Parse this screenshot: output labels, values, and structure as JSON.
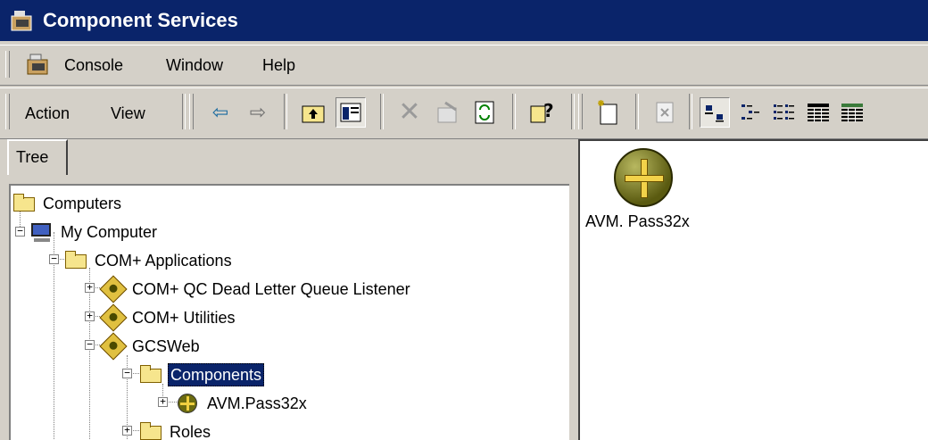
{
  "window": {
    "title": "Component Services"
  },
  "menu": {
    "items": [
      "Console",
      "Window",
      "Help"
    ]
  },
  "toolbar": {
    "action_label": "Action",
    "view_label": "View",
    "icons": [
      "back-icon",
      "forward-icon",
      "up-level-icon",
      "show-hide-tree-icon",
      "delete-icon",
      "properties-icon",
      "refresh-icon",
      "help-icon",
      "new-icon",
      "export-list-icon",
      "large-icons-view-icon",
      "small-icons-view-icon",
      "list-view-icon",
      "detail-view-icon",
      "status-view-icon"
    ]
  },
  "tabs": {
    "tree": "Tree"
  },
  "tree": {
    "computers": "Computers",
    "my_computer": "My Computer",
    "com_apps": "COM+ Applications",
    "qc_listener": "COM+ QC Dead Letter Queue Listener",
    "utilities": "COM+ Utilities",
    "gcsweb": "GCSWeb",
    "components": "Components",
    "avm": "AVM.Pass32x",
    "roles": "Roles"
  },
  "details": {
    "item_label": "AVM. Pass32x"
  },
  "colors": {
    "titlebar": "#0a246a",
    "selection": "#0a246a",
    "face": "#d4d0c8"
  }
}
